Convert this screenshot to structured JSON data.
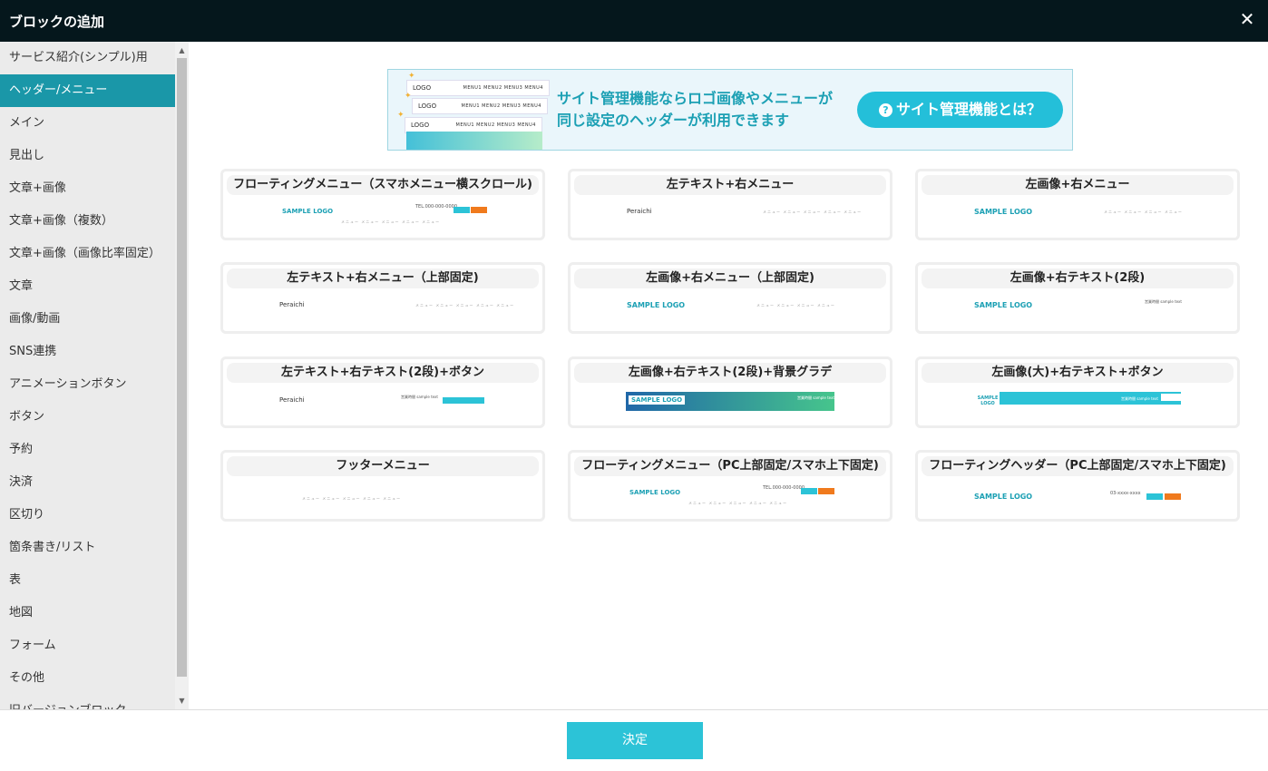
{
  "window": {
    "title": "ブロックの追加",
    "close_icon": "✕"
  },
  "sidebar": {
    "items": [
      {
        "label": "サービス紹介(シンプル)用"
      },
      {
        "label": "ヘッダー/メニュー",
        "active": true
      },
      {
        "label": "メイン"
      },
      {
        "label": "見出し"
      },
      {
        "label": "文章+画像"
      },
      {
        "label": "文章+画像（複数）"
      },
      {
        "label": "文章+画像（画像比率固定）"
      },
      {
        "label": "文章"
      },
      {
        "label": "画像/動画"
      },
      {
        "label": "SNS連携"
      },
      {
        "label": "アニメーションボタン"
      },
      {
        "label": "ボタン"
      },
      {
        "label": "予約"
      },
      {
        "label": "決済"
      },
      {
        "label": "区切り"
      },
      {
        "label": "箇条書き/リスト"
      },
      {
        "label": "表"
      },
      {
        "label": "地図"
      },
      {
        "label": "フォーム"
      },
      {
        "label": "その他"
      },
      {
        "label": "旧バージョンブロック"
      }
    ]
  },
  "banner": {
    "message_line1": "サイト管理機能ならロゴ画像やメニューが",
    "message_line2": "同じ設定のヘッダーが利用できます",
    "button_label": "サイト管理機能とは？",
    "button_icon": "?",
    "mock_logo": "LOGO",
    "mock_menus": "MENU1  MENU2  MENU3  MENU4",
    "accent": "#24bfd9"
  },
  "cards": [
    {
      "title": "フローティングメニュー（スマホメニュー横スクロール)",
      "logo": "SAMPLE LOGO",
      "tel": "TEL.000-000-0000",
      "btn1": "ボタン",
      "btn2": "ボタン",
      "menu": "メニュー メニュー メニュー メニュー メニュー"
    },
    {
      "title": "左テキスト+右メニュー",
      "text": "Peraichi",
      "menu": "メニュー メニュー メニュー メニュー メニュー"
    },
    {
      "title": "左画像+右メニュー",
      "logo": "SAMPLE LOGO",
      "menu": "メニュー メニュー メニュー メニュー"
    },
    {
      "title": "左テキスト+右メニュー（上部固定)",
      "text": "Peraichi",
      "menu": "メニュー メニュー メニュー メニュー メニュー"
    },
    {
      "title": "左画像+右メニュー（上部固定)",
      "logo": "SAMPLE LOGO",
      "menu": "メニュー メニュー メニュー メニュー"
    },
    {
      "title": "左画像+右テキスト(2段)",
      "logo": "SAMPLE LOGO",
      "info": "営業時間 sample text"
    },
    {
      "title": "左テキスト+右テキスト(2段)+ボタン",
      "text": "Peraichi",
      "info": "営業時間 sample text",
      "btn1": "ボタン"
    },
    {
      "title": "左画像+右テキスト(2段)+背景グラデ",
      "logo": "SAMPLE LOGO",
      "info": "営業時間 sample text"
    },
    {
      "title": "左画像(大)+右テキスト+ボタン",
      "logo": "SAMPLE LOGO",
      "info": "営業時間 sample text",
      "btn1": "ボタン"
    },
    {
      "title": "フッターメニュー",
      "menu": "メニュー メニュー メニュー メニュー メニュー"
    },
    {
      "title": "フローティングメニュー（PC上部固定/スマホ上下固定)",
      "logo": "SAMPLE LOGO",
      "tel": "TEL.000-000-0000",
      "btn1": "ボタン",
      "btn2": "ボタン",
      "menu": "メニュー メニュー メニュー メニュー メニュー"
    },
    {
      "title": "フローティングヘッダー（PC上部固定/スマホ上下固定)",
      "logo": "SAMPLE LOGO",
      "tel": "03-xxxx-xxxx",
      "btn1": "ボタン",
      "btn2": "ボタン"
    }
  ],
  "footer": {
    "confirm_label": "決定"
  },
  "colors": {
    "teal": "#1a97a8",
    "cyan": "#2cc3d7",
    "orange": "#f07a1d",
    "dark": "#05171c"
  }
}
